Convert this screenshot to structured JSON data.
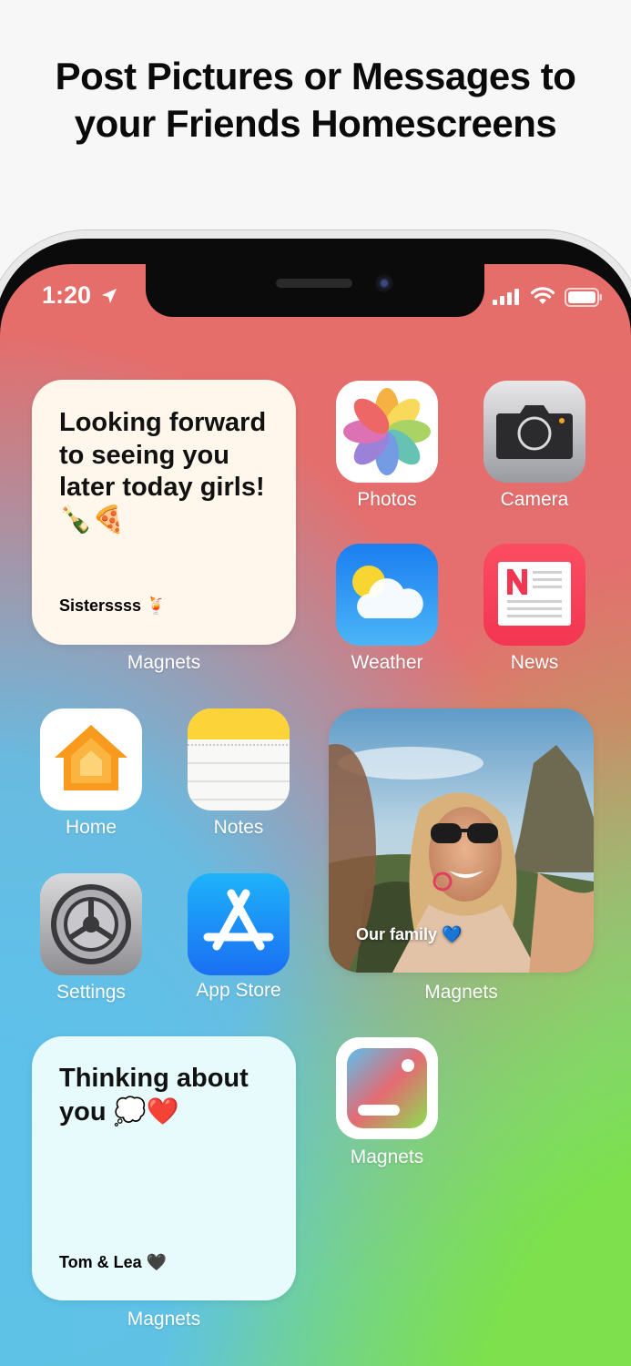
{
  "headline": {
    "line1": "Post Pictures or Messages to",
    "line2": "your Friends Homescreens"
  },
  "status_bar": {
    "time": "1:20",
    "location_icon": "location-arrow-icon",
    "signal_icon": "cellular-signal-icon",
    "wifi_icon": "wifi-icon",
    "battery_icon": "battery-icon"
  },
  "widgets": [
    {
      "app": "Magnets",
      "message": "Looking forward to seeing you later today girls! 🍾🍕",
      "sender": "Sisterssss 🍹",
      "background": "#fff6ec"
    },
    {
      "app": "Magnets",
      "caption": "Our family 💙",
      "image": "photo of smiling woman with sunglasses taking a selfie"
    },
    {
      "app": "Magnets",
      "message": "Thinking about you 💭❤️",
      "sender": "Tom & Lea 🖤",
      "background": "#e7fbfd"
    }
  ],
  "apps": [
    {
      "label": "Photos",
      "icon": "photos-flower-icon"
    },
    {
      "label": "Camera",
      "icon": "camera-icon"
    },
    {
      "label": "Weather",
      "icon": "weather-sun-cloud-icon"
    },
    {
      "label": "News",
      "icon": "news-icon"
    },
    {
      "label": "Home",
      "icon": "home-house-icon"
    },
    {
      "label": "Notes",
      "icon": "notes-icon"
    },
    {
      "label": "Settings",
      "icon": "settings-gear-icon"
    },
    {
      "label": "App Store",
      "icon": "app-store-icon"
    },
    {
      "label": "Magnets",
      "icon": "magnets-app-icon"
    }
  ],
  "colors": {
    "wallpaper_red": "#e56d6a",
    "wallpaper_blue": "#5dc1ea",
    "wallpaper_green": "#7de04c"
  }
}
